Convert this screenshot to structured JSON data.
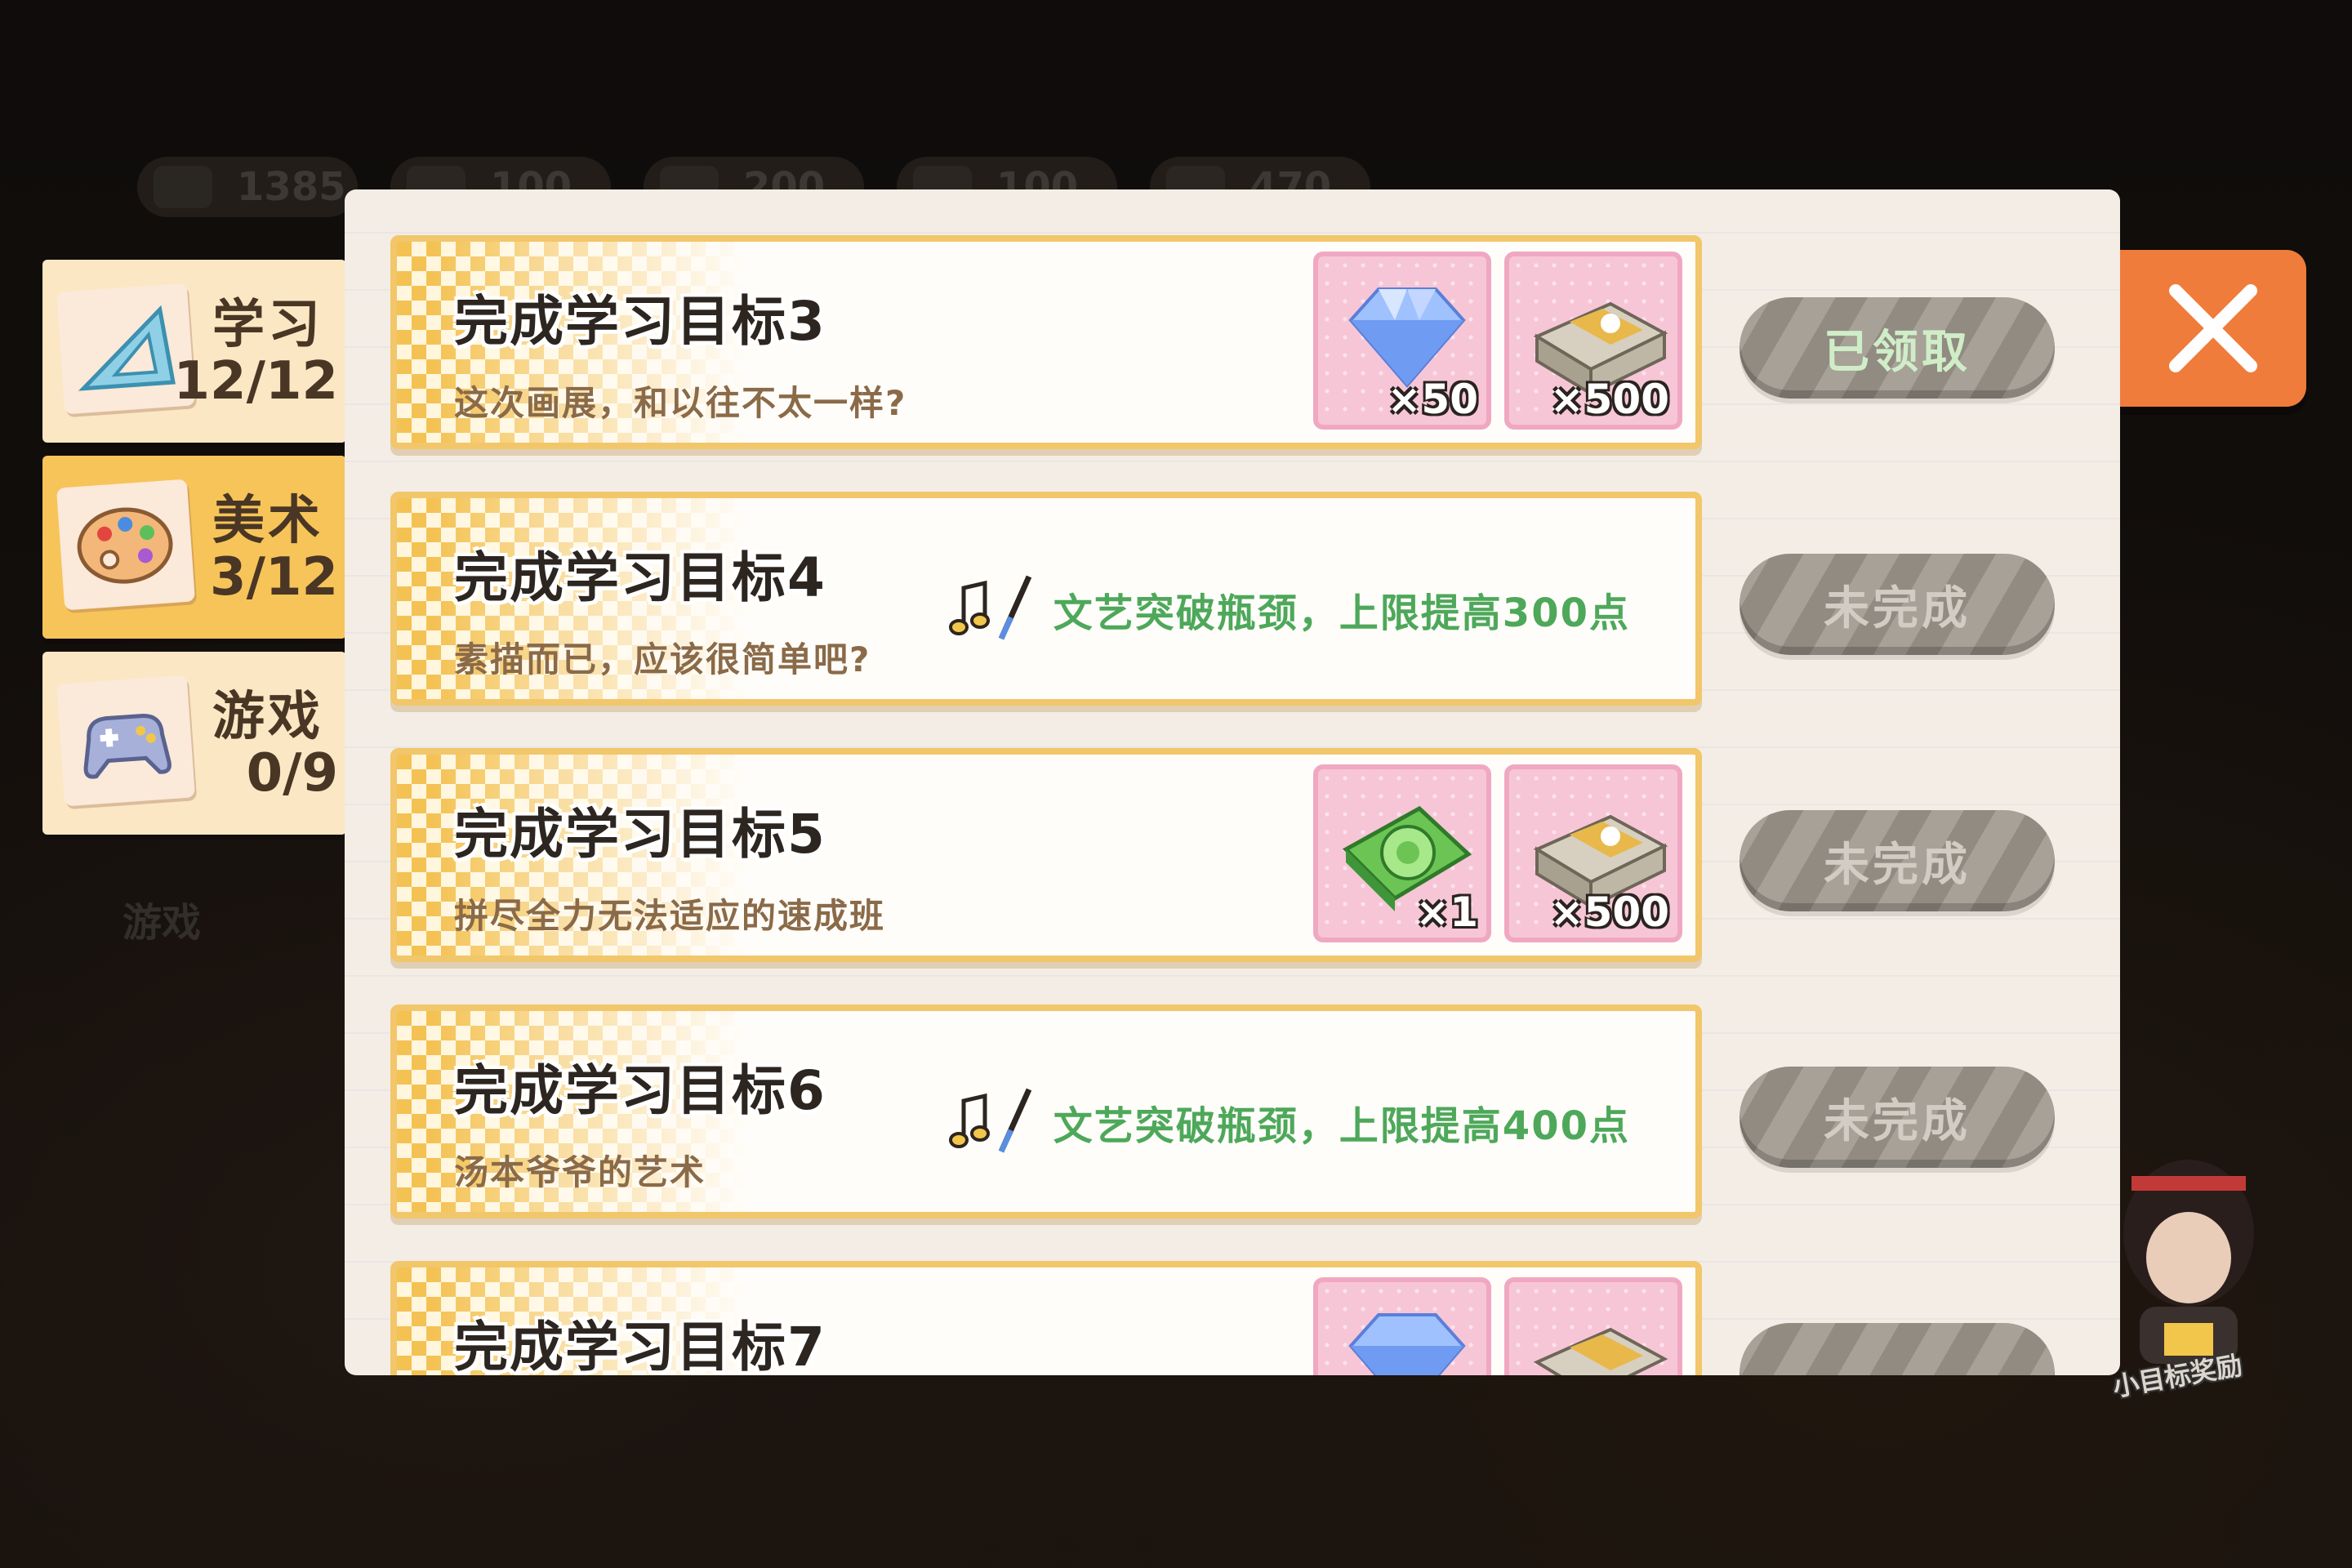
{
  "resources": [
    {
      "icon": "graduation-cap-icon",
      "value": "1385"
    },
    {
      "icon": "resource-icon-2",
      "value": "100"
    },
    {
      "icon": "resource-icon-3",
      "value": "200"
    },
    {
      "icon": "resource-icon-4",
      "value": "100"
    },
    {
      "icon": "resource-icon-5",
      "value": "470"
    }
  ],
  "tabs": [
    {
      "name": "学习",
      "progress": "12/12",
      "icon": "ruler-triangle-icon",
      "active": false
    },
    {
      "name": "美术",
      "progress": "3/12",
      "icon": "palette-icon",
      "active": true
    },
    {
      "name": "游戏",
      "progress": "0/9",
      "icon": "gamepad-icon",
      "active": false
    }
  ],
  "side_label": "游戏",
  "goals": [
    {
      "title": "完成学习目标3",
      "subtitle": "这次画展，和以往不太一样?",
      "rewards": [
        {
          "icon": "diamond-icon",
          "count": "×50"
        },
        {
          "icon": "cash-stack-icon",
          "count": "×500"
        }
      ],
      "status": "已领取"
    },
    {
      "title": "完成学习目标4",
      "subtitle": "素描而已，应该很简单吧?",
      "unlock": {
        "icon": "music-brush-icon",
        "text": "文艺突破瓶颈，上限提高300点"
      },
      "status": "未完成"
    },
    {
      "title": "完成学习目标5",
      "subtitle": "拼尽全力无法适应的速成班",
      "rewards": [
        {
          "icon": "green-ticket-icon",
          "count": "×1"
        },
        {
          "icon": "cash-stack-icon",
          "count": "×500"
        }
      ],
      "status": "未完成"
    },
    {
      "title": "完成学习目标6",
      "subtitle": "汤本爷爷的艺术",
      "unlock": {
        "icon": "music-brush-icon",
        "text": "文艺突破瓶颈，上限提高400点"
      },
      "status": "未完成"
    },
    {
      "title": "完成学习目标7",
      "subtitle": "",
      "status": ""
    }
  ],
  "mascot_label": "小目标奖励",
  "colors": {
    "accent_orange": "#ef7c3a",
    "tab_active": "#f7c45a",
    "unlock_green": "#4ea85a",
    "row_border": "#f2c66a"
  }
}
